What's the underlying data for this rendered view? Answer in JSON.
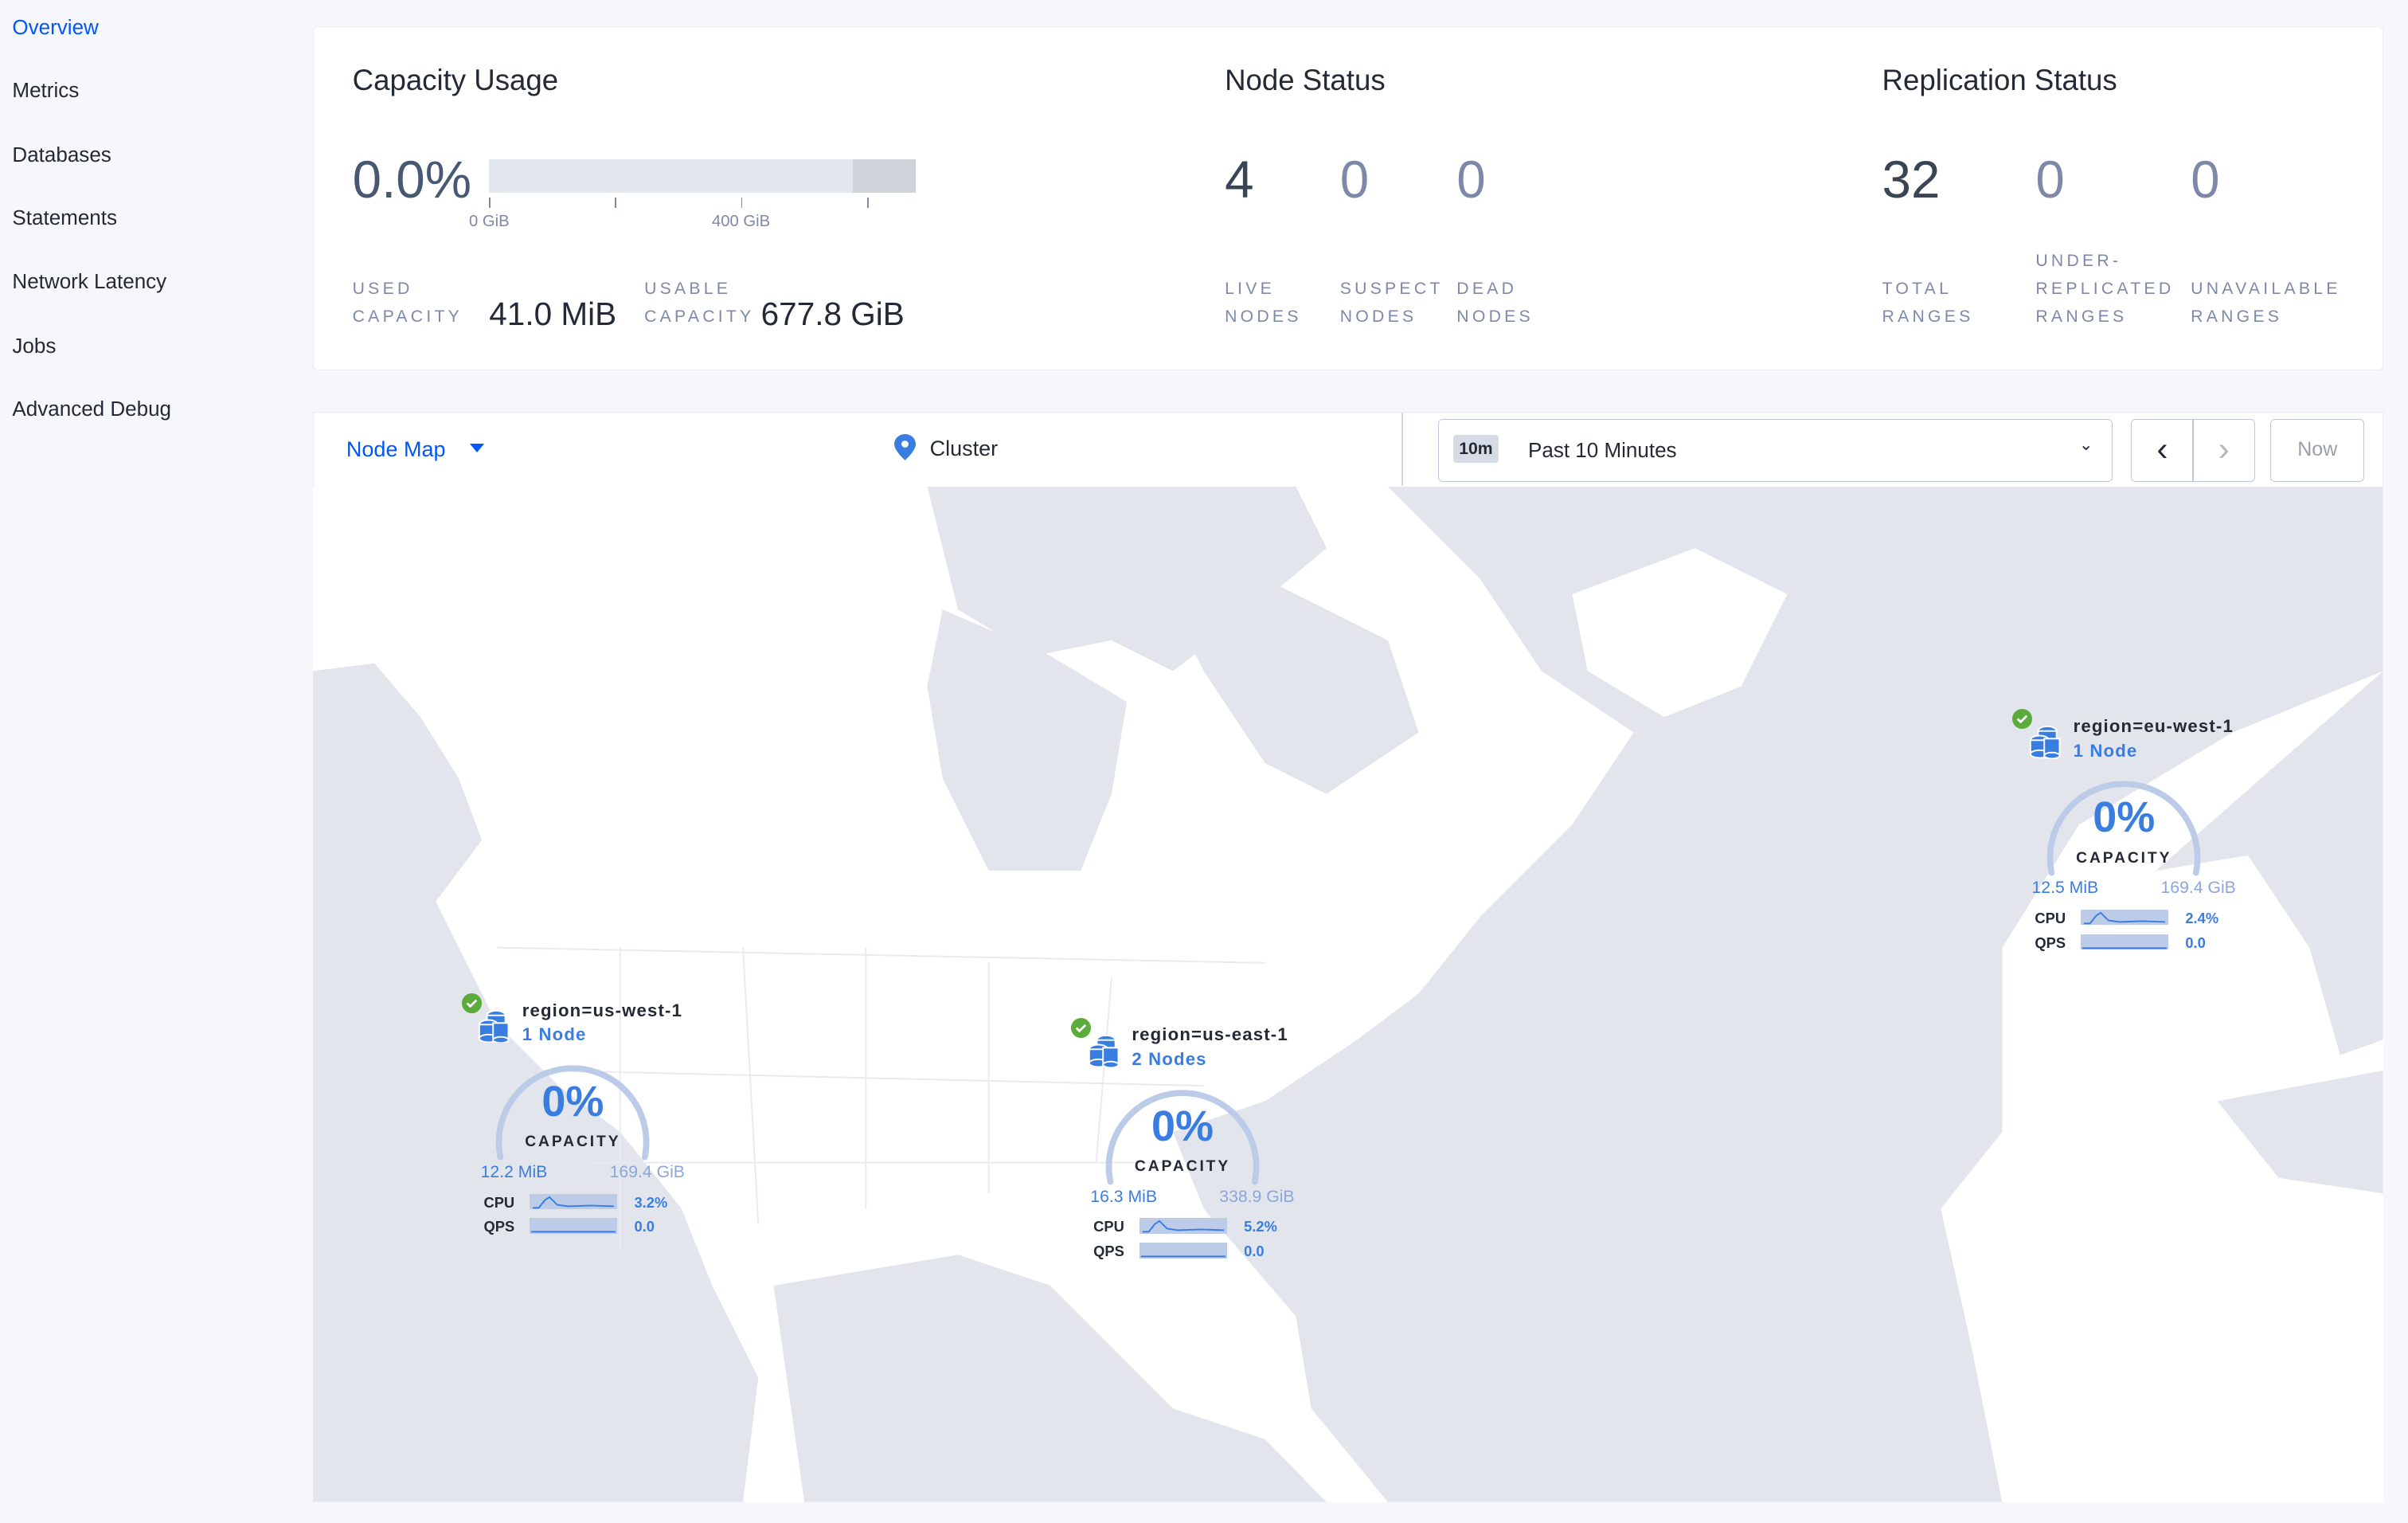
{
  "sidebar": {
    "items": [
      {
        "label": "Overview",
        "active": true
      },
      {
        "label": "Metrics"
      },
      {
        "label": "Databases"
      },
      {
        "label": "Statements"
      },
      {
        "label": "Network Latency"
      },
      {
        "label": "Jobs"
      },
      {
        "label": "Advanced Debug"
      }
    ]
  },
  "capacity": {
    "title": "Capacity Usage",
    "percent": "0.0%",
    "usage_fraction": 0.0,
    "ticks": [
      "0 GiB",
      "400 GiB"
    ],
    "used_label": "USED CAPACITY",
    "used_value": "41.0 MiB",
    "usable_label": "USABLE CAPACITY",
    "usable_value": "677.8 GiB"
  },
  "node_status": {
    "title": "Node Status",
    "stats": [
      {
        "value": "4",
        "label": "LIVE NODES"
      },
      {
        "value": "0",
        "label": "SUSPECT NODES"
      },
      {
        "value": "0",
        "label": "DEAD NODES"
      }
    ]
  },
  "replication": {
    "title": "Replication Status",
    "stats": [
      {
        "value": "32",
        "label": "TOTAL RANGES"
      },
      {
        "value": "0",
        "label": "UNDER-REPLICATED RANGES"
      },
      {
        "value": "0",
        "label": "UNAVAILABLE RANGES"
      }
    ]
  },
  "toolbar": {
    "view": "Node Map",
    "breadcrumb": "Cluster",
    "range_badge": "10m",
    "range_label": "Past 10 Minutes",
    "now_label": "Now"
  },
  "colors": {
    "accent": "#3a7de1",
    "link": "#0055ff",
    "healthy": "#5cac3b",
    "land": "#e2e5ec"
  },
  "nodes": [
    {
      "name": "region=us-west-1",
      "count": "1 Node",
      "percent": "0%",
      "capacity_label": "CAPACITY",
      "used": "12.2 MiB",
      "total": "169.4 GiB",
      "cpu_label": "CPU",
      "cpu": "3.2%",
      "qps_label": "QPS",
      "qps": "0.0"
    },
    {
      "name": "region=us-east-1",
      "count": "2 Nodes",
      "percent": "0%",
      "capacity_label": "CAPACITY",
      "used": "16.3 MiB",
      "total": "338.9 GiB",
      "cpu_label": "CPU",
      "cpu": "5.2%",
      "qps_label": "QPS",
      "qps": "0.0"
    },
    {
      "name": "region=eu-west-1",
      "count": "1 Node",
      "percent": "0%",
      "capacity_label": "CAPACITY",
      "used": "12.5 MiB",
      "total": "169.4 GiB",
      "cpu_label": "CPU",
      "cpu": "2.4%",
      "qps_label": "QPS",
      "qps": "0.0"
    }
  ]
}
